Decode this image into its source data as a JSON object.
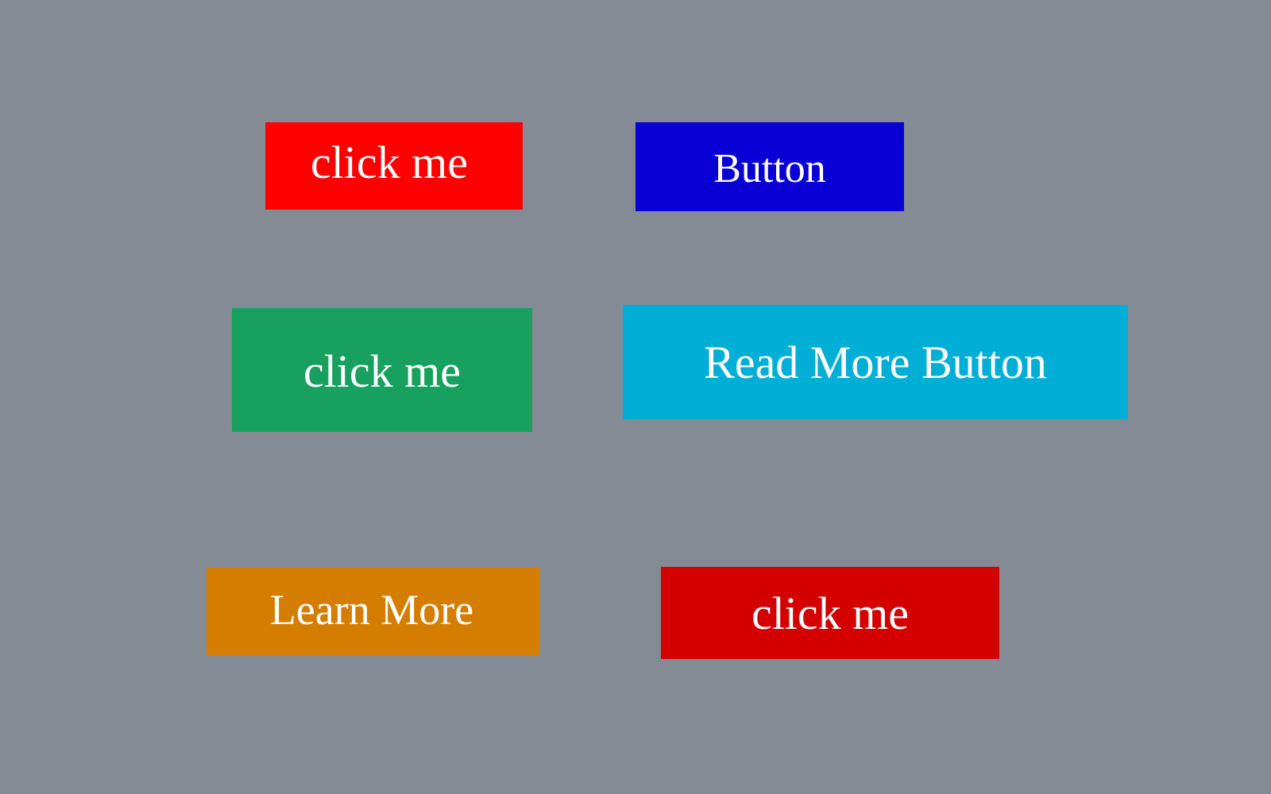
{
  "background_color": "#848b94",
  "buttons": [
    {
      "label": "click me",
      "color": "#ff0000"
    },
    {
      "label": "Button",
      "color": "#0800d4"
    },
    {
      "label": "click me",
      "color": "#18a05e"
    },
    {
      "label": "Read More Button",
      "color": "#00aed6"
    },
    {
      "label": "Learn More",
      "color": "#d47d00"
    },
    {
      "label": "click me",
      "color": "#d40000"
    }
  ]
}
